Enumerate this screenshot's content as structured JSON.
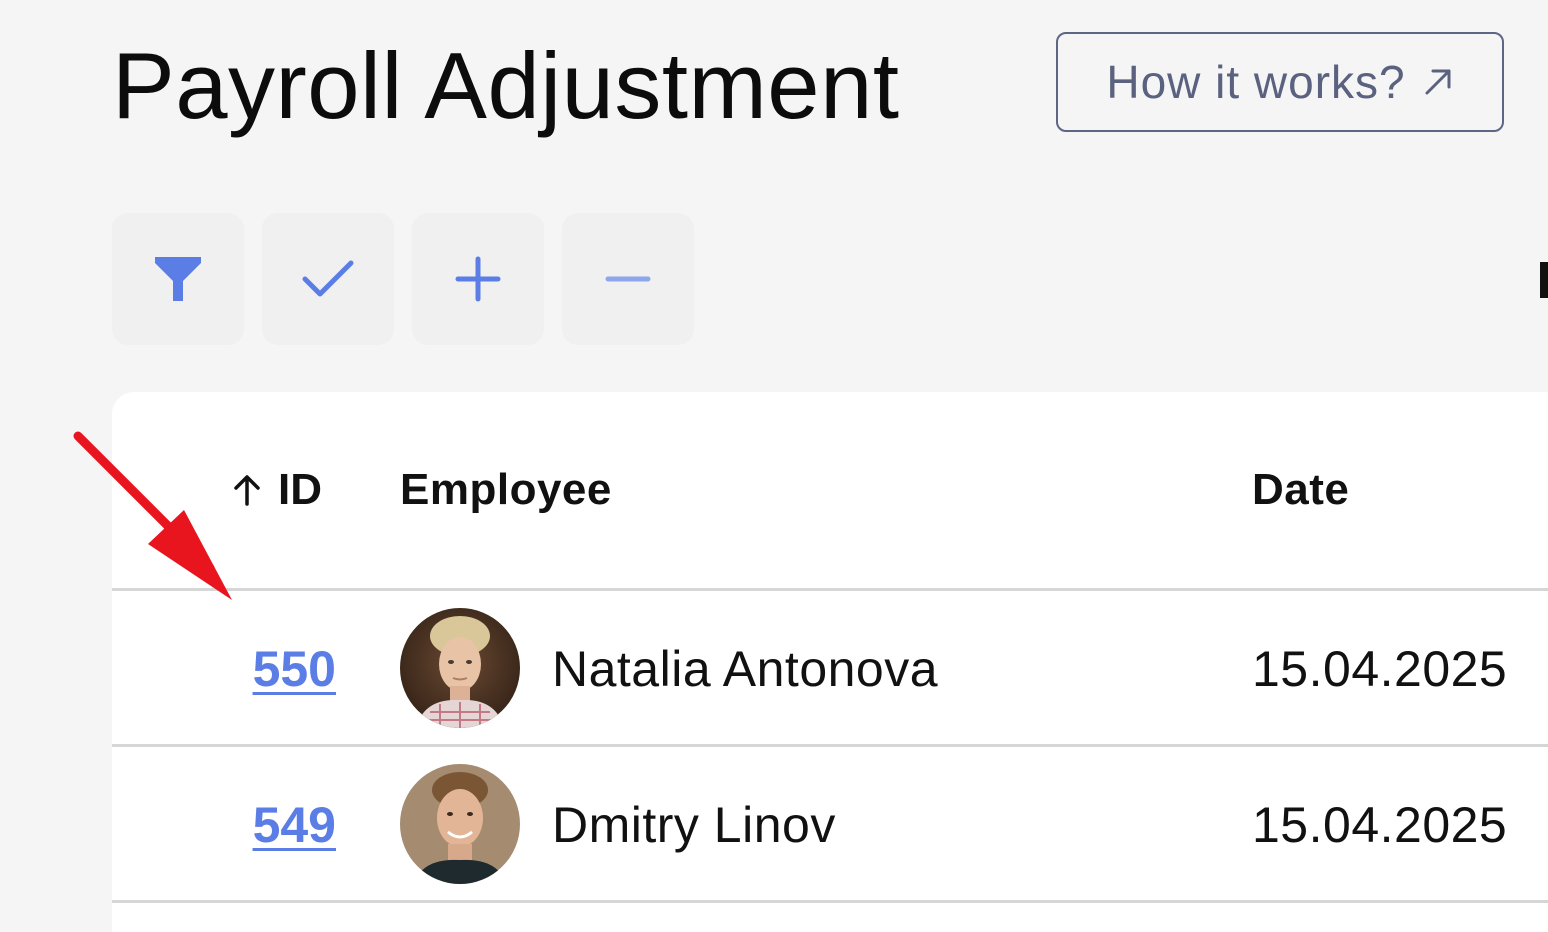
{
  "header": {
    "title": "Payroll Adjustment",
    "help_button_label": "How it works?",
    "help_button_icon": "external-link-arrow-icon"
  },
  "toolbar": {
    "accent_color": "#5b7ee6",
    "buttons": [
      {
        "name": "filter",
        "icon": "funnel-icon"
      },
      {
        "name": "approve",
        "icon": "check-icon"
      },
      {
        "name": "add",
        "icon": "plus-icon"
      },
      {
        "name": "remove",
        "icon": "minus-icon"
      }
    ]
  },
  "table": {
    "columns": {
      "id": "ID",
      "id_sort": "ascending",
      "employee": "Employee",
      "date": "Date"
    },
    "rows": [
      {
        "id": "550",
        "employee": "Natalia Antonova",
        "date": "15.04.2025",
        "avatar": "photo-woman"
      },
      {
        "id": "549",
        "employee": "Dmitry Linov",
        "date": "15.04.2025",
        "avatar": "photo-man"
      }
    ],
    "link_color": "#5b7ee6"
  },
  "annotation": {
    "type": "arrow",
    "color": "#e8141e",
    "points_to": "first row ID link"
  }
}
